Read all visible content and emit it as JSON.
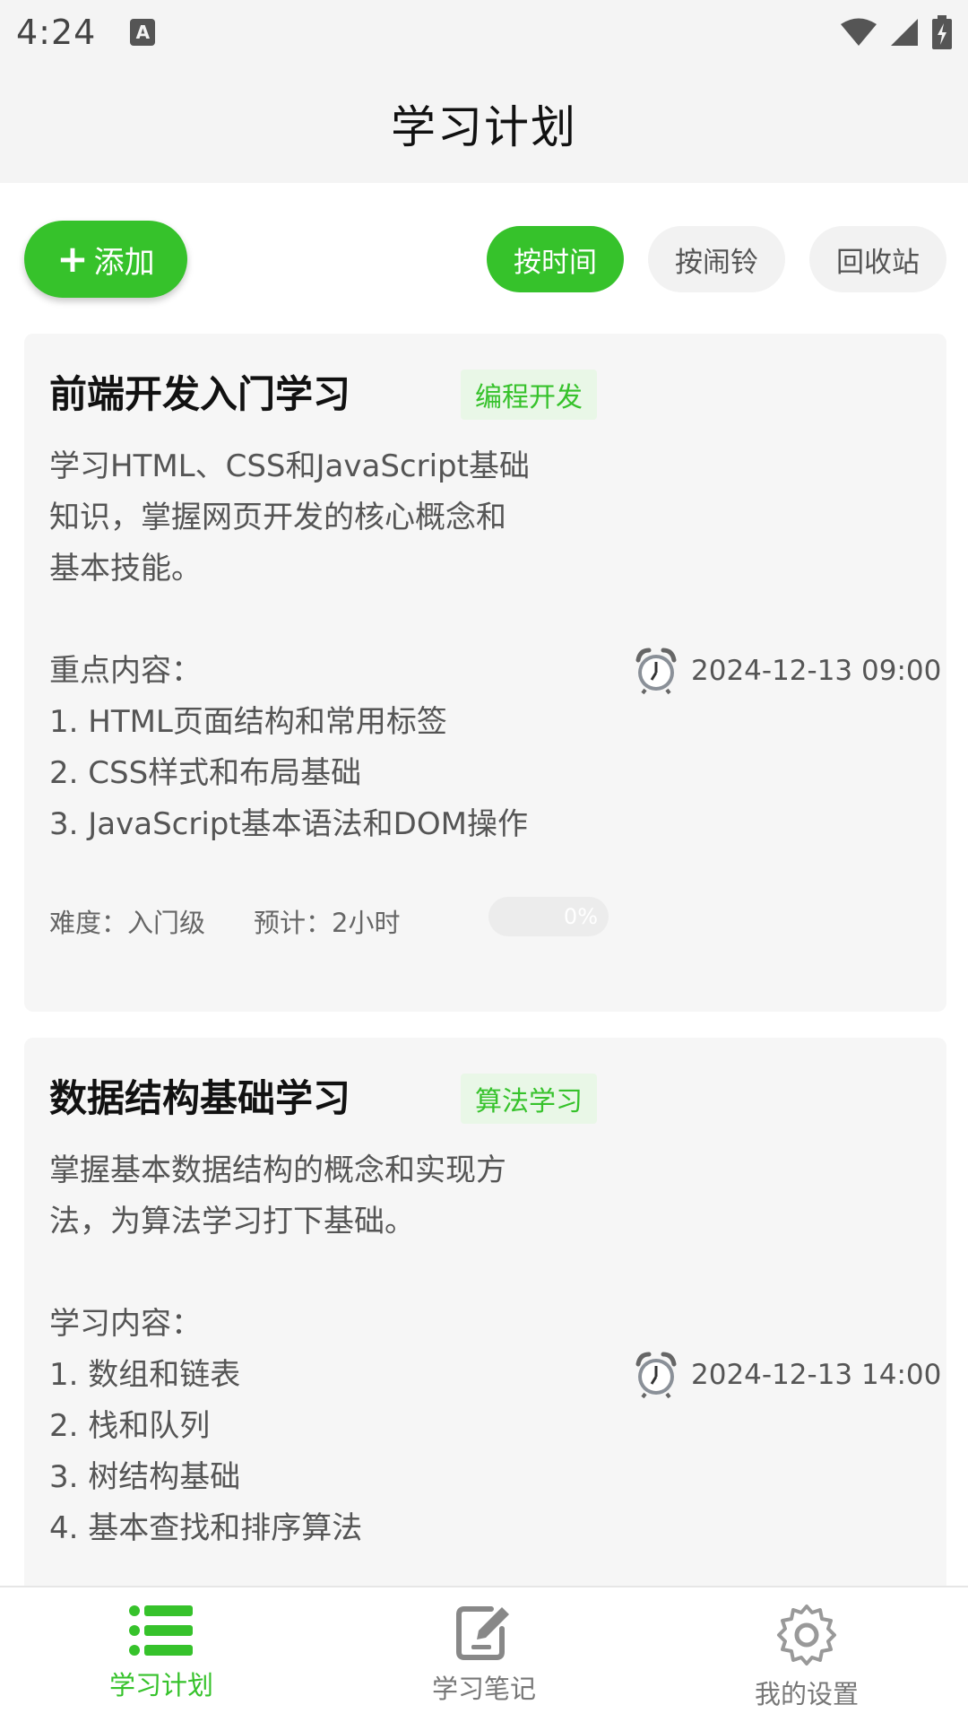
{
  "status_bar": {
    "time": "4:24",
    "notification_icon_letter": "A"
  },
  "header": {
    "title": "学习计划"
  },
  "toolbar": {
    "add_label": "添加",
    "filters": [
      {
        "label": "按时间",
        "active": true
      },
      {
        "label": "按闹铃",
        "active": false
      },
      {
        "label": "回收站",
        "active": false
      }
    ]
  },
  "cards": [
    {
      "title": "前端开发入门学习",
      "tag": "编程开发",
      "description": "学习HTML、CSS和JavaScript基础\n知识，掌握网页开发的核心概念和\n基本技能。\n\n重点内容：\n1. HTML页面结构和常用标签\n2. CSS样式和布局基础\n3. JavaScript基本语法和DOM操作",
      "time": "2024-12-13 09:00",
      "difficulty": "难度：入门级",
      "estimate": "预计：2小时",
      "progress_percent": 0,
      "progress_label": "0%"
    },
    {
      "title": "数据结构基础学习",
      "tag": "算法学习",
      "description": "掌握基本数据结构的概念和实现方\n法，为算法学习打下基础。\n\n学习内容：\n1. 数组和链表\n2. 栈和队列\n3. 树结构基础\n4. 基本查找和排序算法",
      "time": "2024-12-13 14:00"
    }
  ],
  "bottom_nav": [
    {
      "label": "学习计划",
      "icon": "list-icon",
      "active": true
    },
    {
      "label": "学习笔记",
      "icon": "note-edit-icon",
      "active": false
    },
    {
      "label": "我的设置",
      "icon": "gear-icon",
      "active": false
    }
  ],
  "colors": {
    "accent": "#36c22b",
    "tag_bg": "#e9f7e7",
    "card_bg": "#f6f6f6"
  }
}
